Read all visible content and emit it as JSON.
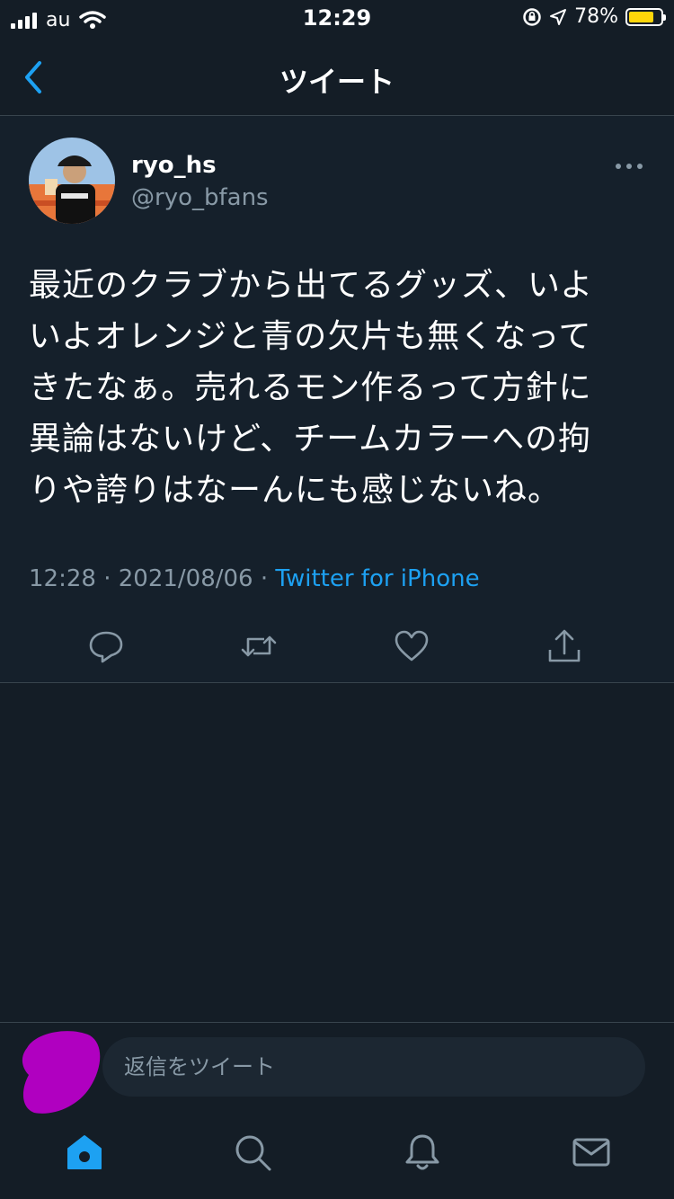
{
  "status_bar": {
    "carrier": "au",
    "time": "12:29",
    "battery_percent": "78%",
    "battery_level": 0.78,
    "icons": [
      "signal-icon",
      "wifi-icon",
      "rotation-lock-icon",
      "location-icon",
      "battery-icon"
    ]
  },
  "nav": {
    "title": "ツイート",
    "back_icon": "chevron-left-icon"
  },
  "tweet": {
    "display_name": "ryo_hs",
    "handle": "@ryo_bfans",
    "text_lines": [
      "最近のクラブから出てるグッズ、いよ",
      "いよオレンジと青の欠片も無くなって",
      "きたなぁ。売れるモン作るって方針に",
      "異論はないけど、チームカラーへの拘",
      "りや誇りはなーんにも感じないね。"
    ],
    "time": "12:28",
    "date": "2021/08/06",
    "separator": "·",
    "source": "Twitter for iPhone",
    "actions": [
      "reply-icon",
      "retweet-icon",
      "like-icon",
      "share-icon"
    ]
  },
  "reply": {
    "placeholder": "返信をツイート"
  },
  "tabs": [
    "home-icon",
    "search-icon",
    "notifications-icon",
    "messages-icon"
  ],
  "colors": {
    "background": "#141d26",
    "tweet_background": "#15202b",
    "accent": "#1da1f2",
    "secondary_text": "#8899a6",
    "divider": "#38444d",
    "battery_fill": "#ffd60a",
    "redaction": "#b000c0"
  }
}
